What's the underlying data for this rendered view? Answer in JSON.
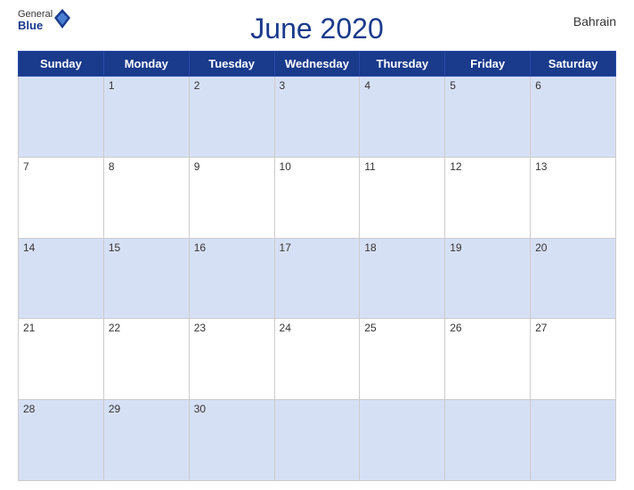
{
  "header": {
    "logo_general": "General",
    "logo_blue": "Blue",
    "title": "June 2020",
    "country": "Bahrain"
  },
  "days_of_week": [
    "Sunday",
    "Monday",
    "Tuesday",
    "Wednesday",
    "Thursday",
    "Friday",
    "Saturday"
  ],
  "weeks": [
    [
      "",
      "1",
      "2",
      "3",
      "4",
      "5",
      "6"
    ],
    [
      "7",
      "8",
      "9",
      "10",
      "11",
      "12",
      "13"
    ],
    [
      "14",
      "15",
      "16",
      "17",
      "18",
      "19",
      "20"
    ],
    [
      "21",
      "22",
      "23",
      "24",
      "25",
      "26",
      "27"
    ],
    [
      "28",
      "29",
      "30",
      "",
      "",
      "",
      ""
    ]
  ]
}
